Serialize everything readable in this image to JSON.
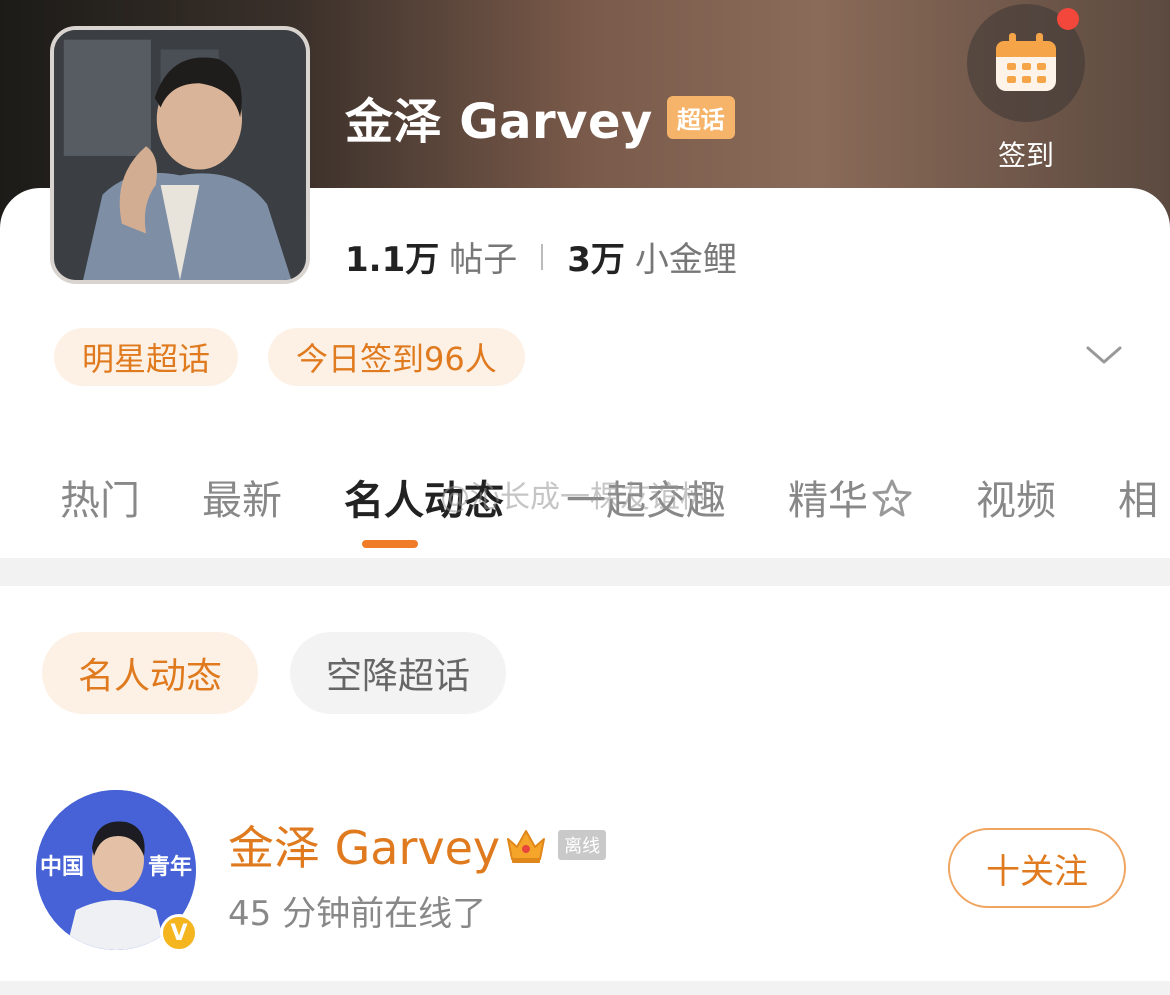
{
  "header": {
    "title": "金泽 Garvey",
    "badge": "超话",
    "checkin_label": "签到",
    "checkin_icon": "calendar-icon",
    "has_notification_dot": true
  },
  "stats": {
    "posts_value": "1.1万",
    "posts_label": "帖子",
    "fans_value": "3万",
    "fans_label": "小金鲤"
  },
  "chips": [
    "明星超话",
    "今日签到96人"
  ],
  "tabs": [
    {
      "label": "热门",
      "active": false
    },
    {
      "label": "最新",
      "active": false
    },
    {
      "label": "名人动态",
      "active": true
    },
    {
      "label": "一起交趣",
      "active": false
    },
    {
      "label": "精华",
      "active": false
    },
    {
      "label": "视频",
      "active": false
    },
    {
      "label": "相",
      "active": false
    }
  ],
  "watermark": "@沁长成一棵友谊树",
  "sub_chips": [
    {
      "label": "名人动态",
      "active": true
    },
    {
      "label": "空降超话",
      "active": false
    }
  ],
  "celebrity": {
    "name": "金泽 Garvey",
    "status_tag": "离线",
    "last_online": "45 分钟前在线了",
    "follow_label": "十关注",
    "verified_mark": "V",
    "avatar_text_left": "中国",
    "avatar_text_right": "青年"
  },
  "colors": {
    "accent": "#e07a1f",
    "chip_bg": "#fdf1e6",
    "badge": "#f5b46a"
  }
}
